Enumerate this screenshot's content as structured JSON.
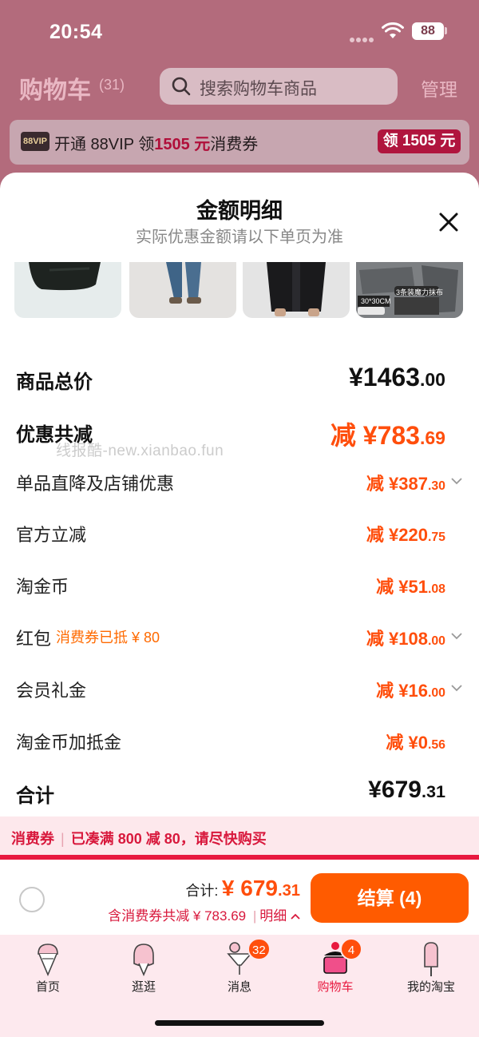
{
  "status_bar": {
    "time": "20:54",
    "battery": "88"
  },
  "header": {
    "title": "购物车",
    "count": "(31)",
    "search_placeholder": "搜索购物车商品",
    "manage": "管理"
  },
  "vip_banner": {
    "badge": "88VIP",
    "text_prefix": "开通 88VIP 领",
    "amount": "1505 元",
    "text_suffix": "消费券",
    "button": "领 1505 元"
  },
  "sheet": {
    "title": "金额明细",
    "subtitle": "实际优惠金额请以下单页为准",
    "thumbnails": [
      {
        "name": "black-bag"
      },
      {
        "name": "jeans"
      },
      {
        "name": "black-jacket"
      },
      {
        "name": "cleaning-cloth",
        "tag_size": "30*30CM",
        "tag_title": "3条装魔力抹布"
      }
    ],
    "rows": {
      "total": {
        "label": "商品总价",
        "int": "¥1463",
        "dec": ".00"
      },
      "discount": {
        "label": "优惠共减",
        "int": "减 ¥783",
        "dec": ".69"
      },
      "shop_discount": {
        "label": "单品直降及店铺优惠",
        "int": "减 ¥387",
        "dec": ".30"
      },
      "official": {
        "label": "官方立减",
        "int": "减 ¥220",
        "dec": ".75"
      },
      "coins": {
        "label": "淘金币",
        "int": "减 ¥51",
        "dec": ".08"
      },
      "red_packet": {
        "label": "红包",
        "note": "消费券已抵 ¥ 80",
        "int": "减 ¥108",
        "dec": ".00"
      },
      "member_gift": {
        "label": "会员礼金",
        "int": "减 ¥16",
        "dec": ".00"
      },
      "coin_credit": {
        "label": "淘金币加抵金",
        "int": "减 ¥0",
        "dec": ".56"
      },
      "sum": {
        "label": "合计",
        "int": "¥679",
        "dec": ".31"
      }
    },
    "watermark": "线报酷-new.xianbao.fun",
    "coupon_bar": {
      "tag": "消费券",
      "text": "已凑满 800 减 80，请尽快购买"
    }
  },
  "checkout": {
    "sum_label": "合计:",
    "sum_int": "¥ 679",
    "sum_dec": ".31",
    "savings": "含消费券共减 ¥ 783.69",
    "detail": "明细",
    "button": "结算 (4)"
  },
  "tabbar": {
    "tabs": [
      {
        "label": "首页"
      },
      {
        "label": "逛逛"
      },
      {
        "label": "消息",
        "badge": "32"
      },
      {
        "label": "购物车",
        "badge": "4"
      },
      {
        "label": "我的淘宝"
      }
    ]
  },
  "colors": {
    "accent": "#ff4e0c",
    "brand_red": "#e8193f",
    "checkout": "#ff5b00"
  }
}
